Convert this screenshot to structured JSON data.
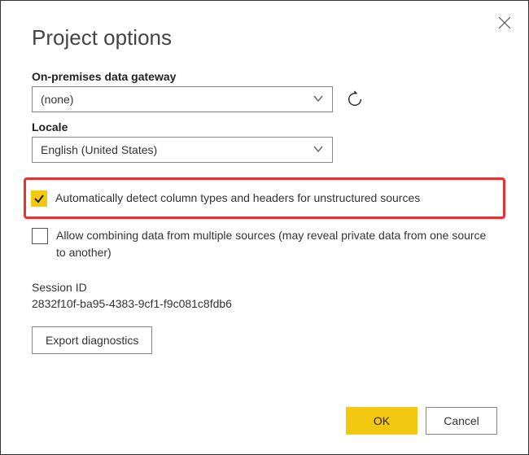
{
  "dialog": {
    "title": "Project options"
  },
  "gateway": {
    "label": "On-premises data gateway",
    "value": "(none)"
  },
  "locale": {
    "label": "Locale",
    "value": "English (United States)"
  },
  "options": {
    "autoDetect": {
      "label": "Automatically detect column types and headers for unstructured sources",
      "checked": true
    },
    "allowCombining": {
      "label": "Allow combining data from multiple sources (may reveal private data from one source to another)",
      "checked": false
    }
  },
  "session": {
    "label": "Session ID",
    "value": "2832f10f-ba95-4383-9cf1-f9c081c8fdb6"
  },
  "buttons": {
    "export": "Export diagnostics",
    "ok": "OK",
    "cancel": "Cancel"
  }
}
